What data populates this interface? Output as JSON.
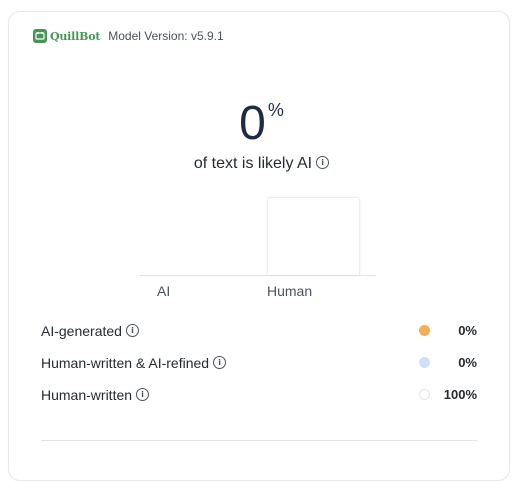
{
  "header": {
    "brand": "QuillBot",
    "model_version": "Model Version: v5.9.1"
  },
  "score": {
    "value": "0",
    "unit": "%",
    "caption": "of text is likely AI"
  },
  "chart_data": {
    "type": "bar",
    "categories": [
      "AI",
      "Human"
    ],
    "values": [
      0,
      100
    ],
    "ylim": [
      0,
      100
    ],
    "title": "",
    "xlabel": "",
    "ylabel": ""
  },
  "legend": [
    {
      "label": "AI-generated",
      "value": "0%",
      "color": "#f4ae55",
      "percent": 0
    },
    {
      "label": "Human-written & AI-refined",
      "value": "0%",
      "color": "#cfe0fb",
      "percent": 0
    },
    {
      "label": "Human-written",
      "value": "100%",
      "color": "#ffffff",
      "percent": 100
    }
  ],
  "colors": {
    "brand": "#499557",
    "score_text": "#1f2a44"
  }
}
